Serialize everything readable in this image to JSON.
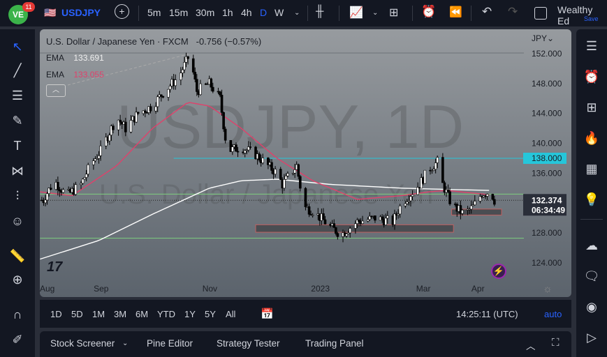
{
  "header": {
    "badge_count": "11",
    "symbol": "USDJPY",
    "timeframes": [
      "5m",
      "15m",
      "30m",
      "1h",
      "4h",
      "D",
      "W"
    ],
    "active_timeframe": "D",
    "user": "Wealthy Ed",
    "save_label": "Save"
  },
  "legend": {
    "title": "U.S. Dollar / Japanese Yen · FXCM",
    "change": "-0.756 (−0.57%)",
    "ema1_label": "EMA",
    "ema1_value": "133.691",
    "ema2_label": "EMA",
    "ema2_value": "133.055"
  },
  "watermark": {
    "symbol": "USDJPY, 1D",
    "name": "U.S. Dollar / Japanese Yen"
  },
  "currency": "JPY",
  "price_labels": [
    "152.000",
    "148.000",
    "144.000",
    "140.000",
    "136.000",
    "128.000",
    "124.000"
  ],
  "highlight_price": "138.000",
  "current": {
    "price": "132.374",
    "countdown": "06:34:49"
  },
  "x_labels": [
    "Aug",
    "Sep",
    "Nov",
    "2023",
    "Mar",
    "Apr"
  ],
  "ranges": [
    "1D",
    "5D",
    "1M",
    "3M",
    "6M",
    "YTD",
    "1Y",
    "5Y",
    "All"
  ],
  "clock": "14:25:11 (UTC)",
  "auto_label": "auto",
  "bottom_tabs": [
    "Stock Screener",
    "Pine Editor",
    "Strategy Tester",
    "Trading Panel"
  ],
  "colors": {
    "accent": "#2962ff",
    "cyan": "#26c6da",
    "ema_fast": "#e0416b",
    "ema_slow": "#ffffff",
    "green_line": "#7ed07e"
  },
  "chart_data": {
    "type": "candlestick",
    "x_unit": "days since 2022-08-01",
    "ylim": [
      122,
      154
    ],
    "key_points": [
      [
        0,
        133
      ],
      [
        5,
        135
      ],
      [
        12,
        133
      ],
      [
        20,
        134.5
      ],
      [
        25,
        137
      ],
      [
        31,
        139
      ],
      [
        40,
        143.5
      ],
      [
        45,
        142
      ],
      [
        52,
        144
      ],
      [
        60,
        145
      ],
      [
        65,
        146.5
      ],
      [
        75,
        149
      ],
      [
        81,
        151.9
      ],
      [
        85,
        147
      ],
      [
        92,
        148
      ],
      [
        98,
        146
      ],
      [
        102,
        139
      ],
      [
        110,
        139.5
      ],
      [
        118,
        138.5
      ],
      [
        125,
        137
      ],
      [
        130,
        136
      ],
      [
        133,
        134.5
      ],
      [
        141,
        137
      ],
      [
        145,
        131.5
      ],
      [
        150,
        131
      ],
      [
        160,
        128.8
      ],
      [
        166,
        127.8
      ],
      [
        175,
        129.5
      ],
      [
        185,
        130
      ],
      [
        195,
        129.5
      ],
      [
        200,
        132
      ],
      [
        210,
        134.5
      ],
      [
        215,
        136.5
      ],
      [
        220,
        137.5
      ],
      [
        223,
        134.5
      ],
      [
        228,
        131.8
      ],
      [
        235,
        130.5
      ],
      [
        240,
        131.5
      ],
      [
        245,
        133.3
      ],
      [
        250,
        133.5
      ],
      [
        252,
        132.4
      ]
    ],
    "ema_fast": [
      [
        -3,
        133.5
      ],
      [
        15,
        133
      ],
      [
        40,
        137
      ],
      [
        60,
        142
      ],
      [
        80,
        145.5
      ],
      [
        92,
        145
      ],
      [
        110,
        142
      ],
      [
        130,
        138
      ],
      [
        150,
        135
      ],
      [
        175,
        132.5
      ],
      [
        200,
        133
      ],
      [
        215,
        133.5
      ],
      [
        225,
        133.7
      ],
      [
        250,
        133.1
      ]
    ],
    "ema_slow": [
      [
        -3,
        124.5
      ],
      [
        30,
        127
      ],
      [
        60,
        130.5
      ],
      [
        92,
        134
      ],
      [
        110,
        135
      ],
      [
        130,
        135.2
      ],
      [
        160,
        134.5
      ],
      [
        200,
        134
      ],
      [
        230,
        133.8
      ],
      [
        250,
        133.7
      ]
    ],
    "hlines": [
      {
        "price": 138,
        "from": 72,
        "color": "cyan"
      },
      {
        "price": 133.2,
        "from": -3,
        "color": "green"
      },
      {
        "price": 127.3,
        "from": -3,
        "color": "green"
      }
    ],
    "zones": [
      {
        "from": 118,
        "to": 229,
        "low": 128.1,
        "high": 129.1
      },
      {
        "from": 228,
        "to": 256,
        "low": 130.4,
        "high": 131.2
      }
    ],
    "x_ticks": [
      [
        0,
        "Aug"
      ],
      [
        31,
        "Sep"
      ],
      [
        92,
        "Nov"
      ],
      [
        153,
        "2023"
      ],
      [
        212,
        "Mar"
      ],
      [
        243,
        "Apr"
      ]
    ]
  }
}
